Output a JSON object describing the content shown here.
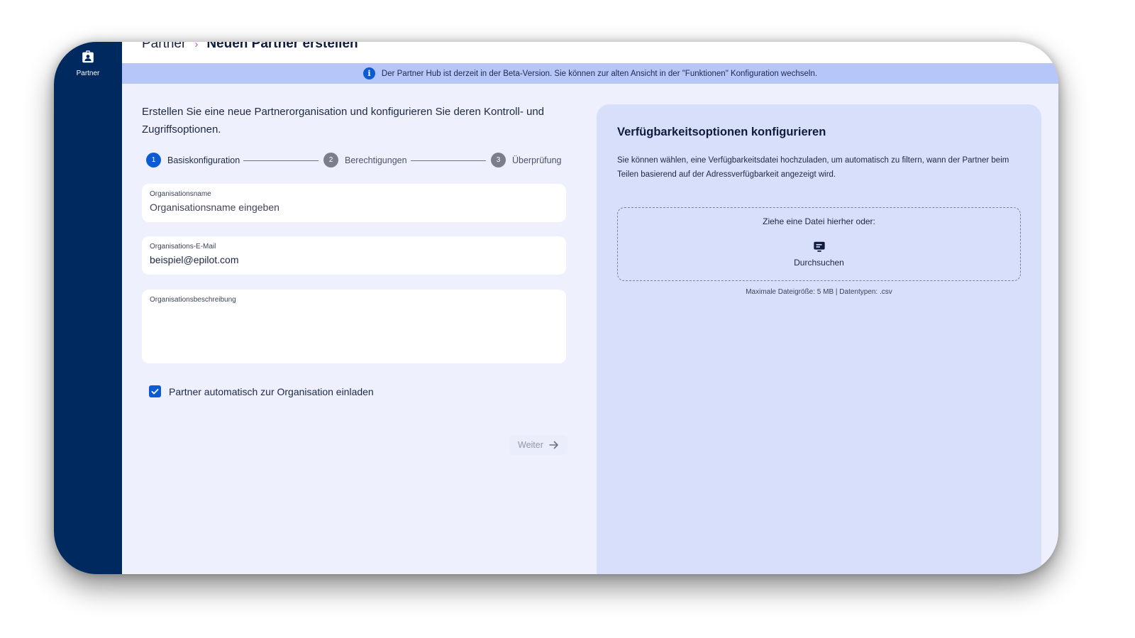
{
  "sidebar": {
    "items": [
      {
        "label": "Partner",
        "icon": "partner-badge-icon"
      }
    ]
  },
  "breadcrumb": {
    "parent": "Partner",
    "separator": "›",
    "current": "Neuen Partner erstellen"
  },
  "banner": {
    "icon": "info-icon",
    "text": "Der Partner Hub ist derzeit in der Beta-Version. Sie können zur alten Ansicht in der \"Funktionen\" Konfiguration wechseln."
  },
  "form": {
    "intro": "Erstellen Sie eine neue Partnerorganisation und konfigurieren Sie deren Kontroll- und Zugriffsoptionen.",
    "steps": [
      {
        "number": "1",
        "label": "Basiskonfiguration",
        "state": "active"
      },
      {
        "number": "2",
        "label": "Berechtigungen",
        "state": "inactive"
      },
      {
        "number": "3",
        "label": "Überprüfung",
        "state": "inactive"
      }
    ],
    "org_name": {
      "label": "Organisationsname",
      "value": "",
      "placeholder": "Organisationsname eingeben"
    },
    "org_email": {
      "label": "Organisations-E-Mail",
      "value": "beispiel@epilot.com"
    },
    "org_description": {
      "label": "Organisationsbeschreibung",
      "value": ""
    },
    "invite_checkbox": {
      "label": "Partner automatisch zur Organisation einladen",
      "checked": true
    },
    "next_button": {
      "label": "Weiter"
    }
  },
  "availability": {
    "title": "Verfügbarkeitsoptionen konfigurieren",
    "description": "Sie können wählen, eine Verfügbarkeitsdatei hochzuladen, um automatisch zu filtern, wann der Partner beim Teilen basierend auf der Adressverfügbarkeit angezeigt wird.",
    "dropzone_text": "Ziehe eine Datei hierher oder:",
    "browse_label": "Durchsuchen",
    "hint": "Maximale Dateigröße: 5 MB  |  Datentypen: .csv"
  },
  "colors": {
    "sidebar": "#002a5f",
    "accent": "#0b5bd3",
    "banner": "#b7c6f8",
    "panel": "#d7dffa",
    "breadcrumb_separator": "#c24ed6"
  }
}
